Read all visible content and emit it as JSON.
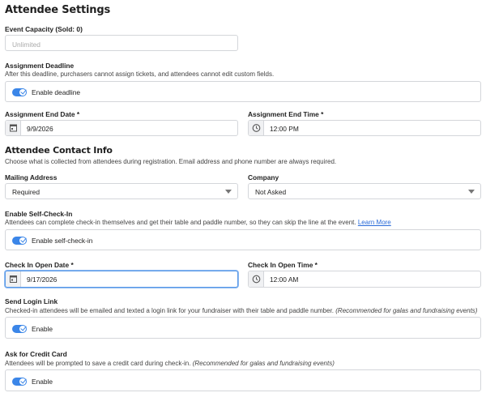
{
  "title": "Attendee Settings",
  "capacity": {
    "label": "Event Capacity (Sold: 0)",
    "placeholder": "Unlimited"
  },
  "deadline": {
    "label": "Assignment Deadline",
    "desc": "After this deadline, purchasers cannot assign tickets, and attendees cannot edit custom fields.",
    "toggle_label": "Enable deadline",
    "end_date_label": "Assignment End Date *",
    "end_date": "9/9/2026",
    "end_time_label": "Assignment End Time *",
    "end_time": "12:00 PM"
  },
  "contact": {
    "heading": "Attendee Contact Info",
    "desc": "Choose what is collected from attendees during registration. Email address and phone number are always required.",
    "mailing_label": "Mailing Address",
    "mailing_value": "Required",
    "company_label": "Company",
    "company_value": "Not Asked"
  },
  "self_checkin": {
    "label": "Enable Self-Check-In",
    "desc": "Attendees can complete check-in themselves and get their table and paddle number, so they can skip the line at the event.",
    "link": "Learn More",
    "toggle_label": "Enable self-check-in",
    "open_date_label": "Check In Open Date *",
    "open_date": "9/17/2026",
    "open_time_label": "Check In Open Time *",
    "open_time": "12:00 AM"
  },
  "login_link": {
    "label": "Send Login Link",
    "desc": "Checked-in attendees will be emailed and texted a login link for your fundraiser with their table and paddle number.",
    "note": "(Recommended for galas and fundraising events)",
    "toggle_label": "Enable"
  },
  "credit_card": {
    "label": "Ask for Credit Card",
    "desc": "Attendees will be prompted to save a credit card during check-in.",
    "note": "(Recommended for galas and fundraising events)",
    "toggle_label": "Enable"
  },
  "colors": {
    "accent": "#3b86e8",
    "border": "#d4d6da",
    "link": "#2a6bd8"
  }
}
